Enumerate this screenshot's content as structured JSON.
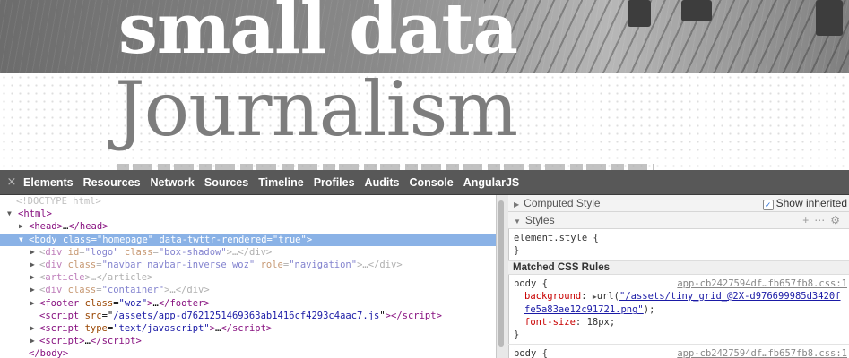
{
  "page": {
    "title_line1": "small data",
    "title_line2": "Journalism"
  },
  "devtools": {
    "close": "×",
    "tabs": [
      "Elements",
      "Resources",
      "Network",
      "Sources",
      "Timeline",
      "Profiles",
      "Audits",
      "Console",
      "AngularJS"
    ],
    "dom": {
      "doctype": "<!DOCTYPE html>",
      "html_open": "<html>",
      "head": [
        "<head>",
        "…",
        "</head>"
      ],
      "body_tag": "body",
      "body_class_attr": "class",
      "body_class_val": "\"homepage\"",
      "body_data_attr": "data-twttr-rendered",
      "body_data_val": "\"true\"",
      "logo": [
        "div",
        "id",
        "\"logo\"",
        "class",
        "\"box-shadow\""
      ],
      "navbar": [
        "div",
        "class",
        "\"navbar navbar-inverse woz\"",
        "role",
        "\"navigation\""
      ],
      "article": "article",
      "container": [
        "div",
        "class",
        "\"container\""
      ],
      "footer": [
        "footer",
        "class",
        "\"woz\""
      ],
      "script_src_attr": "src",
      "script_src_val": "/assets/app-d7621251469363ab1416cf4293c4aac7.js",
      "script_type_attr": "type",
      "script_type_val": "\"text/javascript\"",
      "script_plain": "script",
      "body_close": "</body>"
    },
    "side": {
      "computed_style": "Computed Style",
      "show_inherited": "Show inherited",
      "styles": "Styles",
      "element_style": "element.style {",
      "close_brace": "}",
      "matched_rules": "Matched CSS Rules",
      "rule1": {
        "selector": "body {",
        "source": "app-cb2427594df…fb657fb8.css:1",
        "bg_prop": "background",
        "bg_url_prefix": "url(",
        "bg_url": "\"/assets/tiny_grid_@2X-d976699985d3420ffe5a83ae12c91721.png\"",
        "bg_suffix": ");",
        "fs_prop": "font-size",
        "fs_val": "18px;"
      },
      "rule2": {
        "selector": "body {",
        "source": "app-cb2427594df…fb657fb8.css:1"
      }
    }
  }
}
